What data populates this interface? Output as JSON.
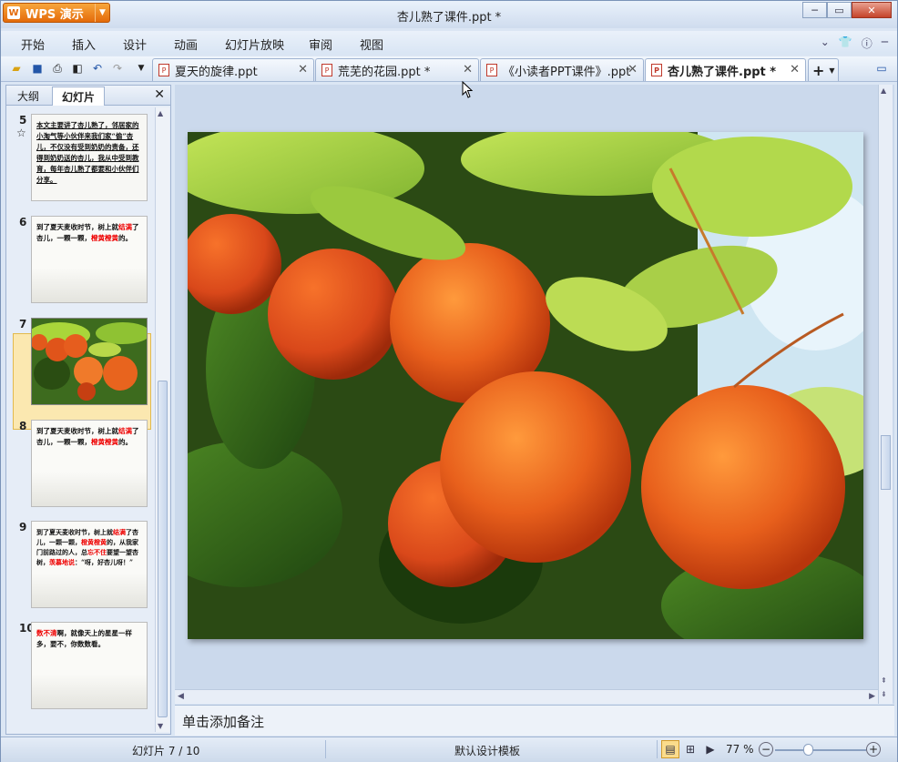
{
  "app": {
    "name": "WPS 演示",
    "logo_letter": "W",
    "doc_title": "杏儿熟了课件.ppt *"
  },
  "window_controls": {
    "minimize": "─",
    "restore": "▭",
    "close": "✕"
  },
  "menu": {
    "items": [
      "开始",
      "插入",
      "设计",
      "动画",
      "幻灯片放映",
      "审阅",
      "视图"
    ]
  },
  "tabs": [
    {
      "label": "夏天的旋律.ppt",
      "active": false
    },
    {
      "label": "荒芜的花园.ppt *",
      "active": false
    },
    {
      "label": "《小读者PPT课件》.ppt",
      "active": false
    },
    {
      "label": "杏儿熟了课件.ppt *",
      "active": true
    }
  ],
  "panel": {
    "tab_outline": "大纲",
    "tab_slides": "幻灯片",
    "close": "✕"
  },
  "slides": [
    {
      "num": "5",
      "star": "☆",
      "text": "本文主要讲了杏儿熟了，邻居家的小淘气等小伙伴来我们家“偷”杏儿，不仅没有受到奶奶的责备，还得到奶奶送的杏儿，我从中受到教育，每年杏儿熟了都要和小伙伴们分享。"
    },
    {
      "num": "6",
      "lines": [
        {
          "t": "到了夏天麦收时节，树上就"
        },
        {
          "t": "结满",
          "hl": true
        },
        {
          "t": "了杏儿，一颗一颗，"
        },
        {
          "t": "橙黄橙黄",
          "hl": true
        },
        {
          "t": "的。"
        }
      ]
    },
    {
      "num": "7",
      "image": true
    },
    {
      "num": "8",
      "lines": [
        {
          "t": "到了夏天麦收时节，树上就"
        },
        {
          "t": "结满",
          "hl": true
        },
        {
          "t": "了杏儿，一颗一颗，"
        },
        {
          "t": "橙黄橙黄",
          "hl": true
        },
        {
          "t": "的。"
        }
      ]
    },
    {
      "num": "9",
      "lines": [
        {
          "t": "到了夏天麦收时节，树上就"
        },
        {
          "t": "结满",
          "hl": true
        },
        {
          "t": "了杏儿，一颗一颗，"
        },
        {
          "t": "橙黄橙黄",
          "hl": true
        },
        {
          "t": "的，从我家门前路过的人，总"
        },
        {
          "t": "忘不住",
          "hl": true
        },
        {
          "t": "要望一望杏树，"
        },
        {
          "t": "羡慕地说",
          "hl": true
        },
        {
          "t": "：“呀，好杏儿呀！”"
        }
      ]
    },
    {
      "num": "10",
      "lines": [
        {
          "t": "数不清",
          "hl": true
        },
        {
          "t": "啊，就像天上的星星一样多，要不，你数数看。"
        }
      ]
    }
  ],
  "notes_placeholder": "单击添加备注",
  "status": {
    "slide_info": "幻灯片 7 / 10",
    "template": "默认设计模板",
    "zoom": "77 %"
  }
}
